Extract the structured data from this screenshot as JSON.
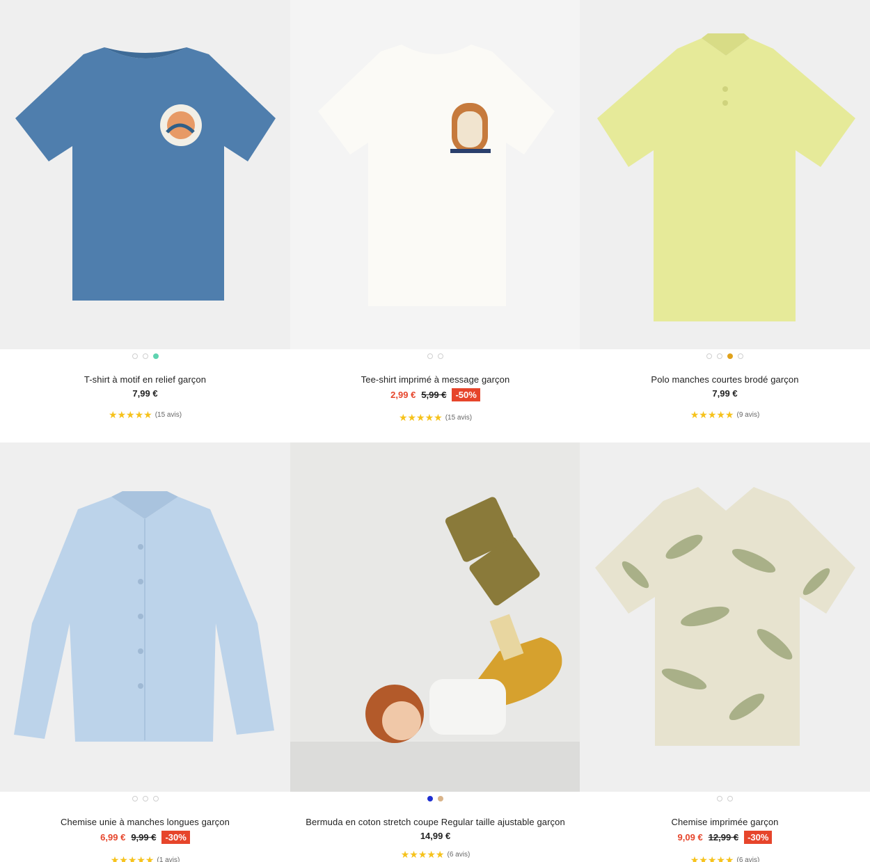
{
  "products": [
    {
      "name": "T-shirt à motif en relief garçon",
      "price": "7,99 €",
      "old_price": "",
      "discount": "",
      "stars": "★★★★★",
      "reviews": "(15 avis)",
      "image_icon": "blue-tshirt-image",
      "colors": [
        "#ffffff",
        "#ffffff",
        "#5fd3b0"
      ]
    },
    {
      "name": "Tee-shirt imprimé à message garçon",
      "price": "2,99 €",
      "old_price": "5,99 €",
      "discount": "-50%",
      "stars": "★★★★★",
      "reviews": "(15 avis)",
      "image_icon": "white-tshirt-tiger-image",
      "colors": [
        "#ffffff",
        "#ffffff"
      ]
    },
    {
      "name": "Polo manches courtes brodé garçon",
      "price": "7,99 €",
      "old_price": "",
      "discount": "",
      "stars": "★★★★★",
      "reviews": "(9 avis)",
      "image_icon": "yellow-polo-image",
      "colors": [
        "#ffffff",
        "#ffffff",
        "#e0a21c",
        "#ffffff"
      ]
    },
    {
      "name": "Chemise unie à manches longues garçon",
      "price": "6,99 €",
      "old_price": "9,99 €",
      "discount": "-30%",
      "stars": "★★★★★",
      "reviews": "(1 avis)",
      "image_icon": "light-blue-shirt-image",
      "colors": [
        "#ffffff",
        "#ffffff",
        "#ffffff"
      ]
    },
    {
      "name": "Bermuda en coton stretch coupe Regular taille ajustable garçon",
      "price": "14,99 €",
      "old_price": "",
      "discount": "",
      "stars": "★★★★★",
      "reviews": "(6 avis)",
      "image_icon": "boy-bermuda-photo",
      "colors": [
        "#1f2fd1",
        "#d9b48a"
      ]
    },
    {
      "name": "Chemise imprimée garçon",
      "price": "9,09 €",
      "old_price": "12,99 €",
      "discount": "-30%",
      "stars": "★★★★★",
      "reviews": "(6 avis)",
      "image_icon": "leaf-print-shirt-image",
      "colors": [
        "#ffffff",
        "#ffffff"
      ]
    }
  ],
  "accent": "#e6452b",
  "star_color": "#f6c21b"
}
